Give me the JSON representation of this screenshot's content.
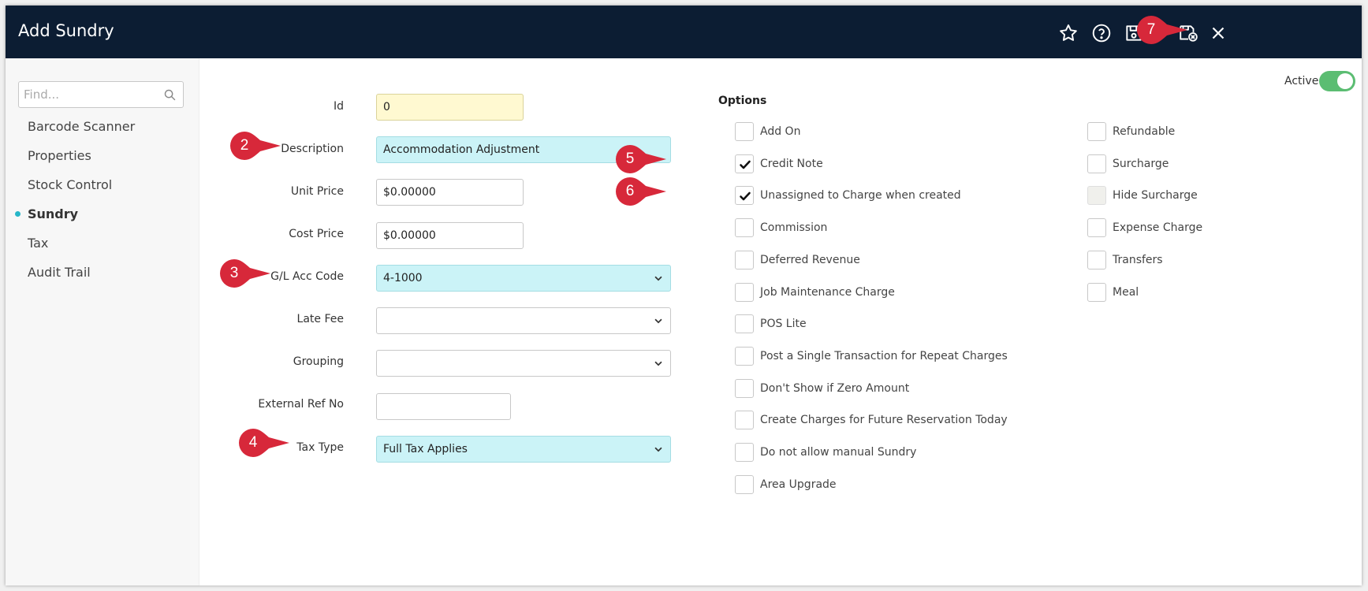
{
  "window": {
    "title": "Add Sundry"
  },
  "toolbar": {
    "icons": [
      "star-icon",
      "help-icon",
      "save-icon",
      "save-and-close-icon",
      "close-icon"
    ]
  },
  "sidebar": {
    "search_placeholder": "Find...",
    "items": [
      {
        "label": "Barcode Scanner",
        "active": false
      },
      {
        "label": "Properties",
        "active": false
      },
      {
        "label": "Stock Control",
        "active": false
      },
      {
        "label": "Sundry",
        "active": true
      },
      {
        "label": "Tax",
        "active": false
      },
      {
        "label": "Audit Trail",
        "active": false
      }
    ]
  },
  "active_toggle": {
    "label": "Active",
    "on": true
  },
  "form": {
    "id": {
      "label": "Id",
      "value": "0"
    },
    "description": {
      "label": "Description",
      "value": "Accommodation Adjustment"
    },
    "unit_price": {
      "label": "Unit Price",
      "value": "$0.00000"
    },
    "cost_price": {
      "label": "Cost Price",
      "value": "$0.00000"
    },
    "gl_acc_code": {
      "label": "G/L Acc Code",
      "value": "4-1000"
    },
    "late_fee": {
      "label": "Late Fee",
      "value": ""
    },
    "grouping": {
      "label": "Grouping",
      "value": ""
    },
    "external_ref": {
      "label": "External Ref No",
      "value": ""
    },
    "tax_type": {
      "label": "Tax Type",
      "value": "Full Tax Applies"
    }
  },
  "options": {
    "title": "Options",
    "left": [
      {
        "label": "Add On",
        "checked": false
      },
      {
        "label": "Credit Note",
        "checked": true
      },
      {
        "label": "Unassigned to Charge when created",
        "checked": true
      },
      {
        "label": "Commission",
        "checked": false
      },
      {
        "label": "Deferred Revenue",
        "checked": false
      },
      {
        "label": "Job Maintenance Charge",
        "checked": false
      },
      {
        "label": "POS Lite",
        "checked": false
      },
      {
        "label": "Post a Single Transaction for Repeat Charges",
        "checked": false
      },
      {
        "label": "Don't Show if Zero Amount",
        "checked": false
      },
      {
        "label": "Create Charges for Future Reservation Today",
        "checked": false
      },
      {
        "label": "Do not allow manual Sundry",
        "checked": false
      },
      {
        "label": "Area Upgrade",
        "checked": false
      }
    ],
    "right": [
      {
        "label": "Refundable",
        "checked": false
      },
      {
        "label": "Surcharge",
        "checked": false
      },
      {
        "label": "Hide Surcharge",
        "checked": false,
        "disabled": true
      },
      {
        "label": "Expense Charge",
        "checked": false
      },
      {
        "label": "Transfers",
        "checked": false
      },
      {
        "label": "Meal",
        "checked": false
      }
    ]
  },
  "callouts": [
    "2",
    "3",
    "4",
    "5",
    "6",
    "7"
  ],
  "colors": {
    "titlebar": "#0c1d33",
    "accent": "#26b6c8",
    "callout": "#d7283a",
    "toggle_on": "#5bbd72",
    "input_cyan": "#cbf3f7",
    "input_yellow": "#fff9d1"
  }
}
